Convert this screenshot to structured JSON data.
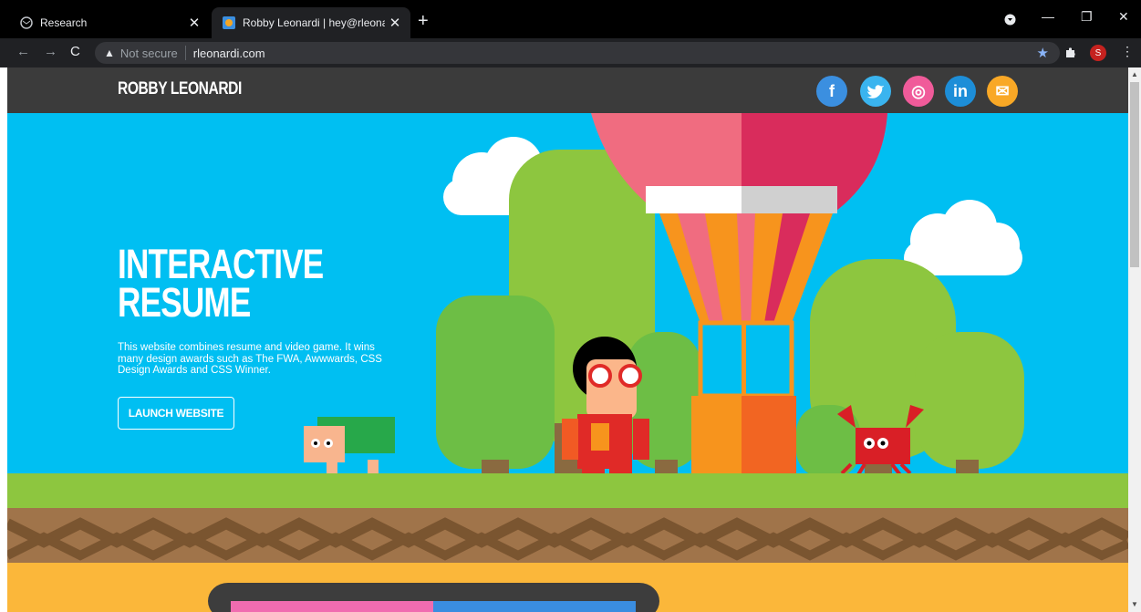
{
  "browser": {
    "tabs": [
      {
        "title": "Research",
        "active": false
      },
      {
        "title": "Robby Leonardi | hey@rleonardi.",
        "active": true
      }
    ],
    "new_tab": "+",
    "security_label": "Not secure",
    "url": "rleonardi.com",
    "profile_initial": "S",
    "icons": [
      "back-icon",
      "forward-icon",
      "reload-icon",
      "warning-icon",
      "star-icon",
      "extensions-icon",
      "menu-icon"
    ]
  },
  "site": {
    "brand": "ROBBY LEONARDI",
    "social": [
      {
        "name": "facebook",
        "glyph": "f",
        "color": "#3b8fe0"
      },
      {
        "name": "twitter",
        "glyph": "t",
        "color": "#3ab4ef"
      },
      {
        "name": "dribbble",
        "glyph": "◎",
        "color": "#f05b9a"
      },
      {
        "name": "linkedin",
        "glyph": "in",
        "color": "#1d8ed8"
      },
      {
        "name": "email",
        "glyph": "✉",
        "color": "#f9a826"
      }
    ],
    "hero": {
      "title_line1": "INTERACTIVE",
      "title_line2": "RESUME",
      "description": "This website combines resume and video game. It wins many design awards such as The FWA, Awwwards, CSS Design Awards and CSS Winner.",
      "cta": "LAUNCH WEBSITE"
    },
    "colors": {
      "sky": "#00bff2",
      "grass": "#8dc63f",
      "ground": "#9a6a3c",
      "sand": "#fbb73a",
      "header": "#3b3b3b"
    }
  }
}
